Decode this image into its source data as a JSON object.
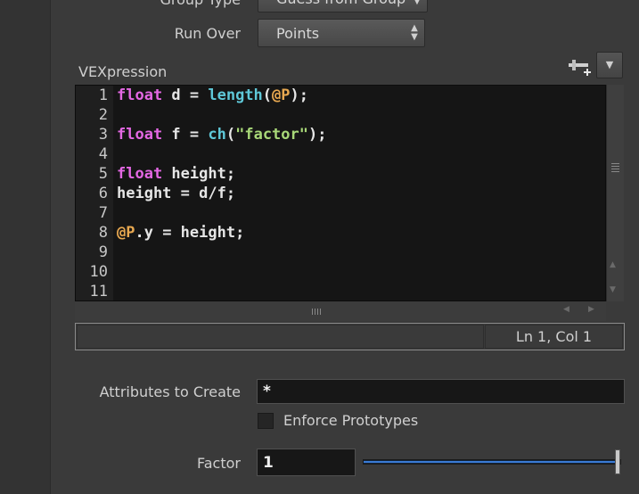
{
  "group_type": {
    "label": "Group Type",
    "value": "Guess from Group"
  },
  "run_over": {
    "label": "Run Over",
    "value": "Points"
  },
  "vexpression": {
    "label": "VEXpression",
    "lines": [
      {
        "num": "1",
        "tokens": [
          [
            "kw",
            "float"
          ],
          [
            "tx",
            " d = "
          ],
          [
            "fn",
            "length"
          ],
          [
            "tx",
            "("
          ],
          [
            "at",
            "@P"
          ],
          [
            "tx",
            ");"
          ]
        ]
      },
      {
        "num": "2",
        "tokens": []
      },
      {
        "num": "3",
        "tokens": [
          [
            "kw",
            "float"
          ],
          [
            "tx",
            " f = "
          ],
          [
            "fn",
            "ch"
          ],
          [
            "tx",
            "("
          ],
          [
            "str",
            "\"factor\""
          ],
          [
            "tx",
            ");"
          ]
        ]
      },
      {
        "num": "4",
        "tokens": []
      },
      {
        "num": "5",
        "tokens": [
          [
            "kw",
            "float"
          ],
          [
            "tx",
            " height;"
          ]
        ]
      },
      {
        "num": "6",
        "tokens": [
          [
            "tx",
            "height = d/f;"
          ]
        ]
      },
      {
        "num": "7",
        "tokens": []
      },
      {
        "num": "8",
        "tokens": [
          [
            "at",
            "@P"
          ],
          [
            "tx",
            ".y = height;"
          ]
        ]
      },
      {
        "num": "9",
        "tokens": []
      },
      {
        "num": "10",
        "tokens": []
      },
      {
        "num": "11",
        "tokens": []
      }
    ],
    "cursor_status": "Ln 1, Col 1"
  },
  "attributes_to_create": {
    "label": "Attributes to Create",
    "value": "*"
  },
  "enforce_prototypes": {
    "label": "Enforce Prototypes",
    "checked": false
  },
  "factor": {
    "label": "Factor",
    "value": "1",
    "slider_fraction": 1.0
  },
  "colors": {
    "keyword": "#e468e4",
    "function": "#5fc8d8",
    "attribute": "#e8a850",
    "string": "#a8d878",
    "slider_fill": "#3a7bd5"
  },
  "icons": {
    "add_spare_parm": "plus-slider-icon",
    "preset_menu": "chevron-down-icon",
    "menu_arrows": "updown-arrows-icon"
  }
}
